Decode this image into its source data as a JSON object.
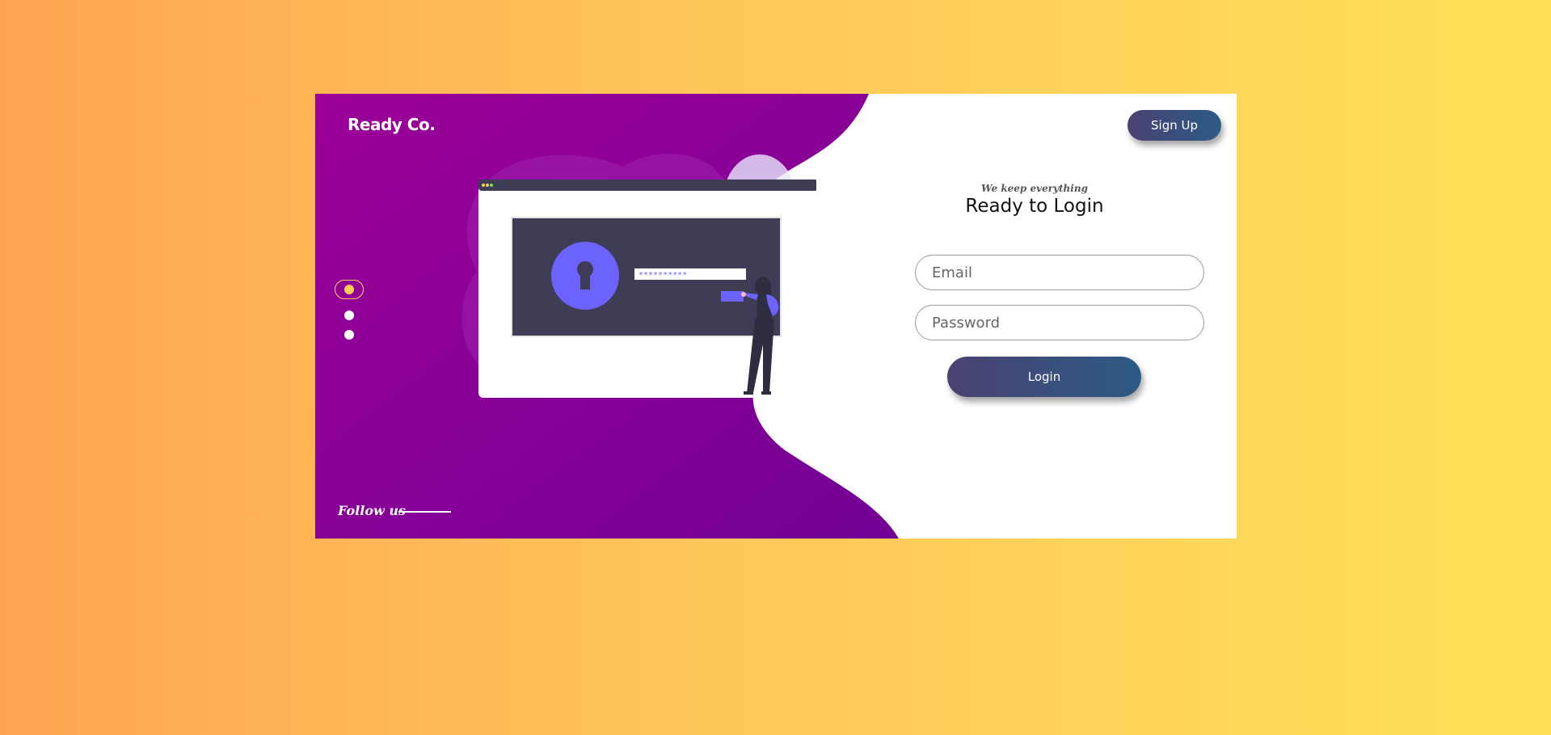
{
  "brand": {
    "name": "Ready Co."
  },
  "header": {
    "signup_label": "Sign Up"
  },
  "carousel": {
    "slides": 3,
    "active_index": 0
  },
  "footer": {
    "follow_label": "Follow us"
  },
  "form": {
    "tagline": "We keep everything",
    "title": "Ready to Login",
    "email_placeholder": "Email",
    "password_placeholder": "Password",
    "login_label": "Login"
  },
  "illustration": {
    "password_mask": "**********"
  },
  "colors": {
    "page_gradient_start": "#ffa552",
    "page_gradient_end": "#ffe158",
    "panel_start": "#9c0097",
    "panel_end": "#720096",
    "button_start": "#4a4272",
    "button_end": "#2c5b85",
    "accent": "#6c63ff",
    "active_dot": "#ffcc5a"
  },
  "icons": [
    "keyhole-icon",
    "leaf-icon",
    "person-illustration"
  ]
}
